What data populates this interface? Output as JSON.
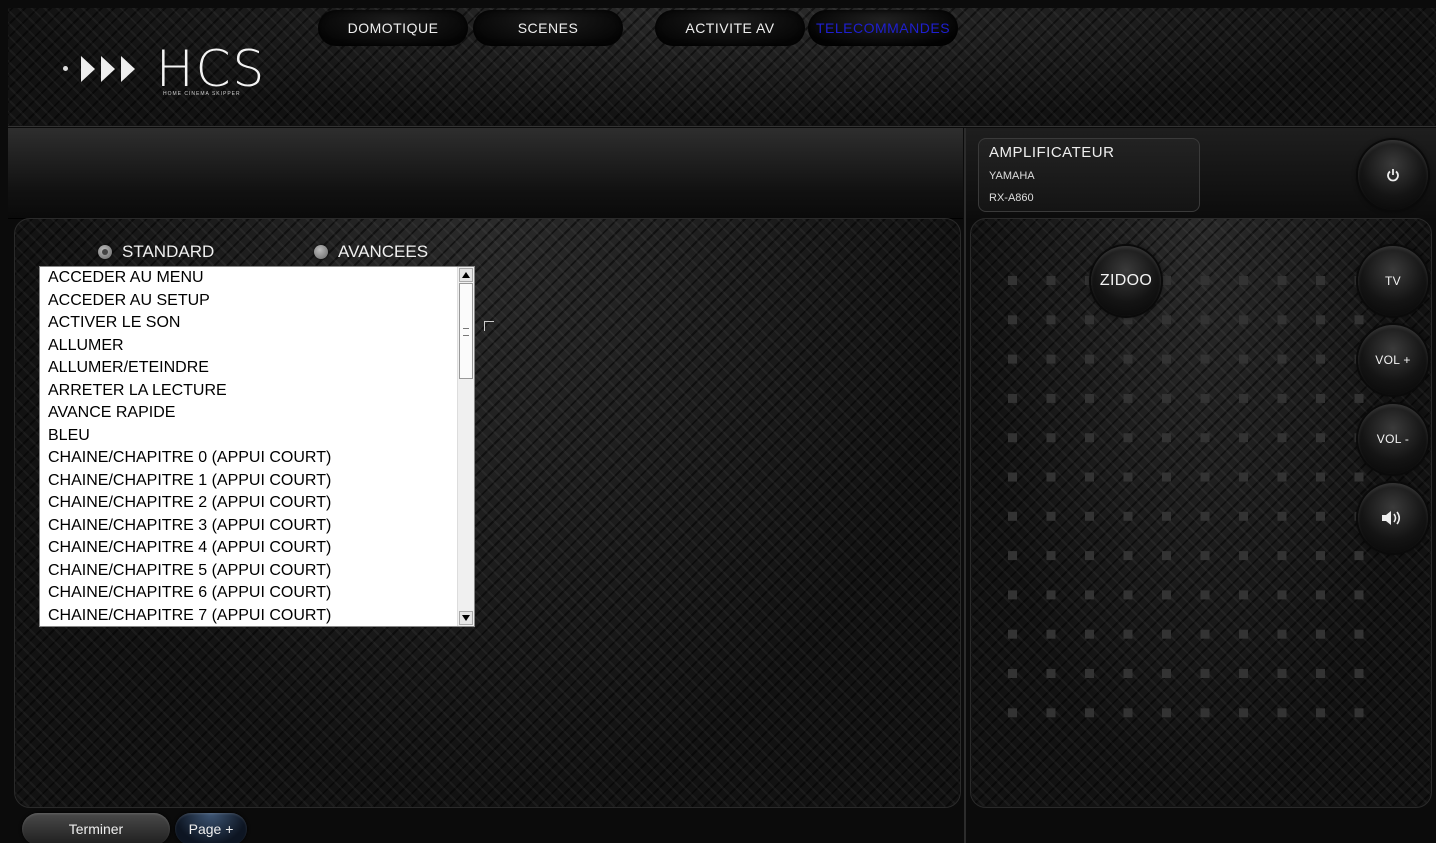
{
  "brand": {
    "name": "HCS",
    "tagline": "HOME CINEMA SKIPPER"
  },
  "nav": {
    "tabs": [
      {
        "label": "DOMOTIQUE"
      },
      {
        "label": "SCENES"
      },
      {
        "label": "ACTIVITE AV"
      },
      {
        "label": "TELECOMMANDES",
        "active": true
      }
    ]
  },
  "device": {
    "type": "AMPLIFICATEUR",
    "brand": "YAMAHA",
    "model": "RX-A860"
  },
  "mode": {
    "standard_label": "STANDARD",
    "advanced_label": "AVANCEES",
    "selected": "STANDARD"
  },
  "commands": [
    "ACCEDER AU MENU",
    "ACCEDER AU SETUP",
    "ACTIVER LE SON",
    "ALLUMER",
    "ALLUMER/ETEINDRE",
    "ARRETER LA LECTURE",
    "AVANCE RAPIDE",
    "BLEU",
    "CHAINE/CHAPITRE 0 (APPUI COURT)",
    "CHAINE/CHAPITRE 1 (APPUI COURT)",
    "CHAINE/CHAPITRE 2 (APPUI COURT)",
    "CHAINE/CHAPITRE 3 (APPUI COURT)",
    "CHAINE/CHAPITRE 4 (APPUI COURT)",
    "CHAINE/CHAPITRE 5 (APPUI COURT)",
    "CHAINE/CHAPITRE 6 (APPUI COURT)",
    "CHAINE/CHAPITRE 7 (APPUI COURT)"
  ],
  "remote": {
    "power_icon": "power-icon",
    "zidoo_label": "ZIDOO",
    "tv_label": "TV",
    "vol_plus_label": "VOL +",
    "vol_minus_label": "VOL -",
    "mute_icon": "speaker-icon"
  },
  "footer": {
    "finish_label": "Terminer",
    "next_page_label": "Page +"
  }
}
